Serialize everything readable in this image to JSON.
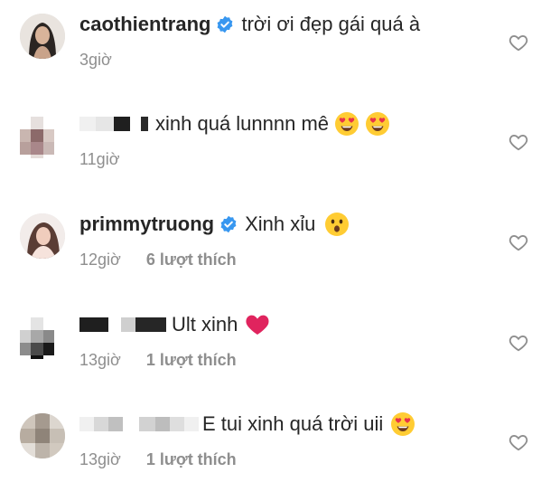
{
  "comments": [
    {
      "username": "caothientrang",
      "verified": true,
      "text": "trời ơi đẹp gái quá à",
      "time": "3giờ",
      "likes": "",
      "emoji": []
    },
    {
      "username": "",
      "verified": false,
      "text": "xinh quá lunnnn mê",
      "time": "11giờ",
      "likes": "",
      "emoji": [
        "heart-eyes-emoji",
        "heart-eyes-emoji"
      ]
    },
    {
      "username": "primmytruong",
      "verified": true,
      "text": "Xinh xỉu",
      "time": "12giờ",
      "likes": "6 lượt thích",
      "emoji": [
        "astonished-emoji"
      ]
    },
    {
      "username": "",
      "verified": false,
      "text": "Ult xinh",
      "time": "13giờ",
      "likes": "1 lượt thích",
      "emoji": [
        "red-heart-emoji"
      ]
    },
    {
      "username": "",
      "verified": false,
      "text": "E tui xinh quá trời uii",
      "time": "13giờ",
      "likes": "1 lượt thích",
      "emoji": [
        "heart-eyes-emoji"
      ]
    }
  ],
  "colors": {
    "text": "#262626",
    "meta": "#8e8e8e",
    "verified": "#3897f0",
    "heart": "#e0245e"
  },
  "icons": {
    "like": "heart-outline-icon",
    "verified": "verified-badge-icon"
  }
}
